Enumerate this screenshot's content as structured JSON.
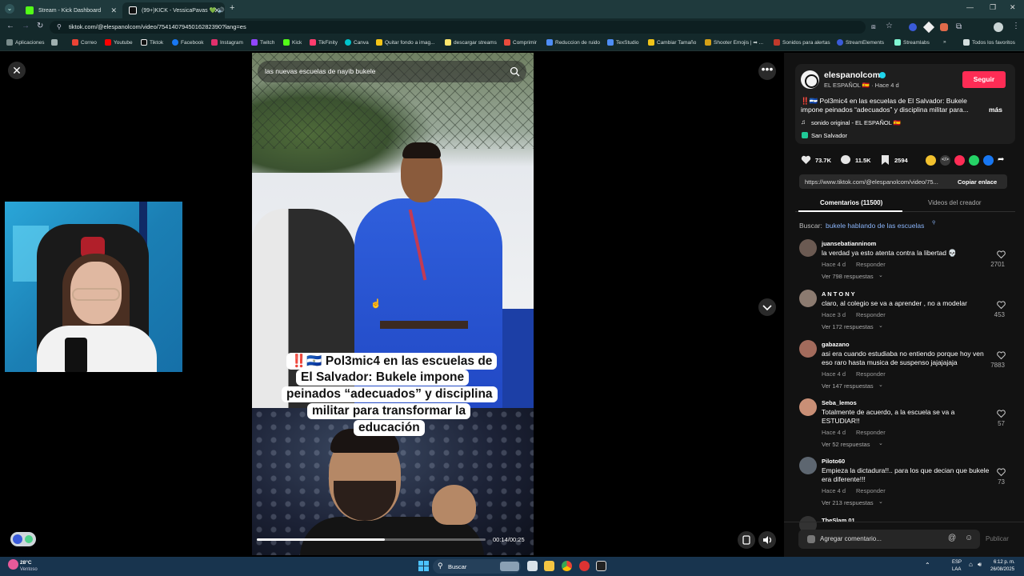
{
  "browser": {
    "tabs": [
      {
        "label": "Stream - Kick Dashboard",
        "color": "#53fc18"
      },
      {
        "label": "(99+)KICK - VessicaPavas 💚 🔊",
        "color": "#ffffff"
      }
    ],
    "url": "tiktok.com/@elespanolcom/video/7541407945016282390?lang=es",
    "bookmarks": [
      {
        "label": "Aplicaciones",
        "color": "#7a8c8c"
      },
      {
        "label": "Correo",
        "color": "#ea4335"
      },
      {
        "label": "Youtube",
        "color": "#ff0000"
      },
      {
        "label": "Tiktok",
        "color": "#111111"
      },
      {
        "label": "Facebook",
        "color": "#1877f2"
      },
      {
        "label": "Instagram",
        "color": "#e1306c"
      },
      {
        "label": "Twitch",
        "color": "#9146ff"
      },
      {
        "label": "Kick",
        "color": "#53fc18"
      },
      {
        "label": "TikFinity",
        "color": "#ff3d6e"
      },
      {
        "label": "Canva",
        "color": "#00c4cc"
      },
      {
        "label": "Quitar fondo a imag...",
        "color": "#f5c518"
      },
      {
        "label": "descargar streams",
        "color": "#ffe66d"
      },
      {
        "label": "Comprimir",
        "color": "#e94b3c"
      },
      {
        "label": "Reduccion de ruido",
        "color": "#4e8df5"
      },
      {
        "label": "TexStudio",
        "color": "#4e8df5"
      },
      {
        "label": "Cambiar Tamaño",
        "color": "#f0c419"
      },
      {
        "label": "Shooter Emojis | ➡ ...",
        "color": "#d4a017"
      },
      {
        "label": "Sonidos para alertas",
        "color": "#c0392b"
      },
      {
        "label": "StreamElements",
        "color": "#3a5bd9"
      },
      {
        "label": "Streamlabs",
        "color": "#80f5d2"
      },
      {
        "label": "»",
        "color": ""
      },
      {
        "label": "Todos los favoritos",
        "color": "#d4dede"
      }
    ]
  },
  "video": {
    "search_text": "las nuevas escuelas de nayib bukele",
    "caption_lines": [
      "‼️🇸🇻 Pol3mic4 en las escuelas de",
      "El Salvador: Bukele impone",
      "peinados “adecuados” y disciplina",
      "militar para transformar la",
      "educación"
    ],
    "time": "00:14/00:25",
    "progress": 0.56
  },
  "post": {
    "username": "elespanolcom",
    "display": "EL ESPAÑOL 🇪🇸 · Hace 4 d",
    "follow_label": "Seguir",
    "description": "‼️🇸🇻 Pol3mic4 en las escuelas de El Salvador: Bukele impone peinados “adecuados” y disciplina militar para...",
    "more": "más",
    "sound": "sonido original - EL ESPAÑOL 🇪🇸",
    "location": "San Salvador",
    "likes": "73.7K",
    "comments": "11.5K",
    "saves": "2594",
    "link": "https://www.tiktok.com/@elespanolcom/video/75...",
    "copy_label": "Copiar enlace",
    "tab_comments": "Comentarios (11500)",
    "tab_creator": "Videos del creador",
    "search_prefix": "Buscar:",
    "search_query": "bukele hablando de las escuelas"
  },
  "comments": [
    {
      "user": "juansebatianninom",
      "text": "la verdad ya esto atenta contra la libertad 💀",
      "time": "Hace 4 d",
      "reply": "Responder",
      "replies": "Ver 798 respuestas",
      "likes": "2701",
      "avatar": "#6b5a52"
    },
    {
      "user": "A N T O N Y",
      "text": "claro, al colegio se va a aprender , no a modelar",
      "time": "Hace 3 d",
      "reply": "Responder",
      "replies": "Ver 172 respuestas",
      "likes": "453",
      "avatar": "#8c7b70"
    },
    {
      "user": "gabazano",
      "text": "asi era cuando estudiaba no entiendo porque hoy ven eso raro hasta musica de suspenso jajajajaja",
      "time": "Hace 4 d",
      "reply": "Responder",
      "replies": "Ver 147 respuestas",
      "likes": "7883",
      "avatar": "#a36b5c"
    },
    {
      "user": "Seba_lemos",
      "text": "Totalmente de acuerdo, a la escuela se va a ESTUDIAR!!",
      "time": "Hace 4 d",
      "reply": "Responder",
      "replies": "Ver 52 respuestas",
      "likes": "57",
      "avatar": "#c98f76"
    },
    {
      "user": "Piloto60",
      "text": "Empieza la dictadura!!.. para los que decian que bukele era diferente!!!",
      "time": "Hace 4 d",
      "reply": "Responder",
      "replies": "Ver 213 respuestas",
      "likes": "73",
      "avatar": "#5d6670"
    },
    {
      "user": "TheSlam 01",
      "text": "",
      "time": "",
      "reply": "",
      "replies": "",
      "likes": "",
      "avatar": "#333"
    }
  ],
  "comment_input": {
    "placeholder": "Agregar comentario...",
    "publish": "Publicar"
  },
  "taskbar": {
    "weather_temp": "28°C",
    "weather_desc": "Ventoso",
    "search_label": "Buscar",
    "lang_top": "ESP",
    "lang_bottom": "LAA",
    "time": "6:12 p. m.",
    "date": "26/08/2025"
  }
}
